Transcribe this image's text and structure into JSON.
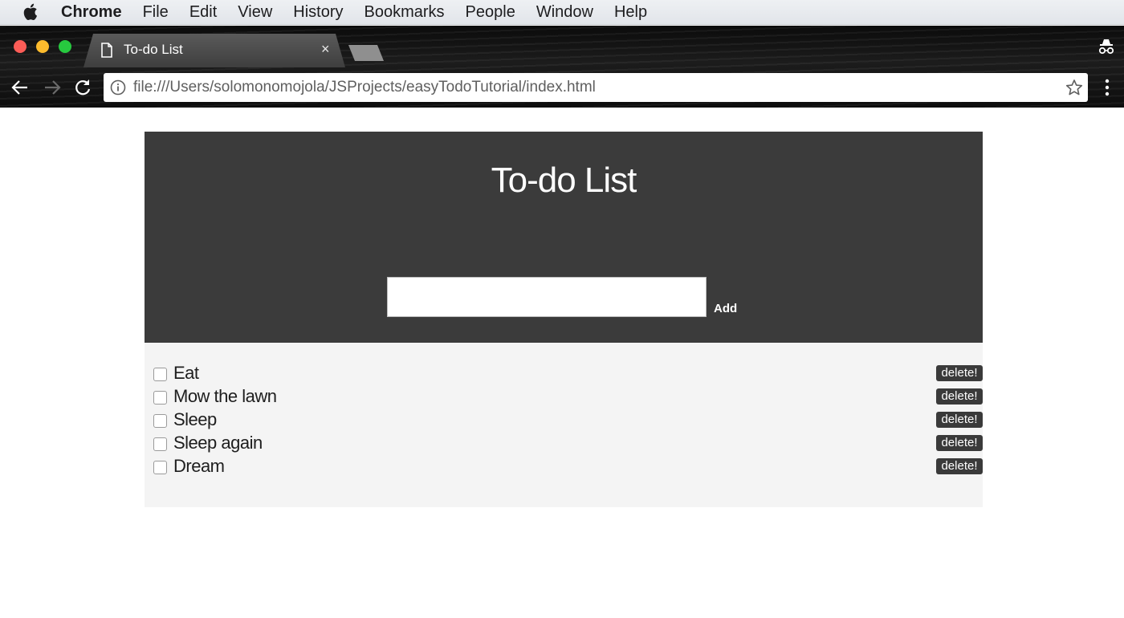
{
  "menubar": {
    "app": "Chrome",
    "items": [
      "File",
      "Edit",
      "View",
      "History",
      "Bookmarks",
      "People",
      "Window",
      "Help"
    ]
  },
  "browser": {
    "tab_title": "To-do List",
    "tab_close": "×",
    "url": "file:///Users/solomonomojola/JSProjects/easyTodoTutorial/index.html"
  },
  "app": {
    "title": "To-do List",
    "input_value": "",
    "add_label": "Add",
    "items": [
      {
        "text": "Eat",
        "checked": false,
        "delete_label": "delete!"
      },
      {
        "text": "Mow the lawn",
        "checked": false,
        "delete_label": "delete!"
      },
      {
        "text": "Sleep",
        "checked": false,
        "delete_label": "delete!"
      },
      {
        "text": "Sleep again",
        "checked": false,
        "delete_label": "delete!"
      },
      {
        "text": "Dream",
        "checked": false,
        "delete_label": "delete!"
      }
    ]
  },
  "colors": {
    "header_bg": "#3b3b3b",
    "list_bg": "#f4f4f4",
    "delete_bg": "#3a3a3a"
  }
}
